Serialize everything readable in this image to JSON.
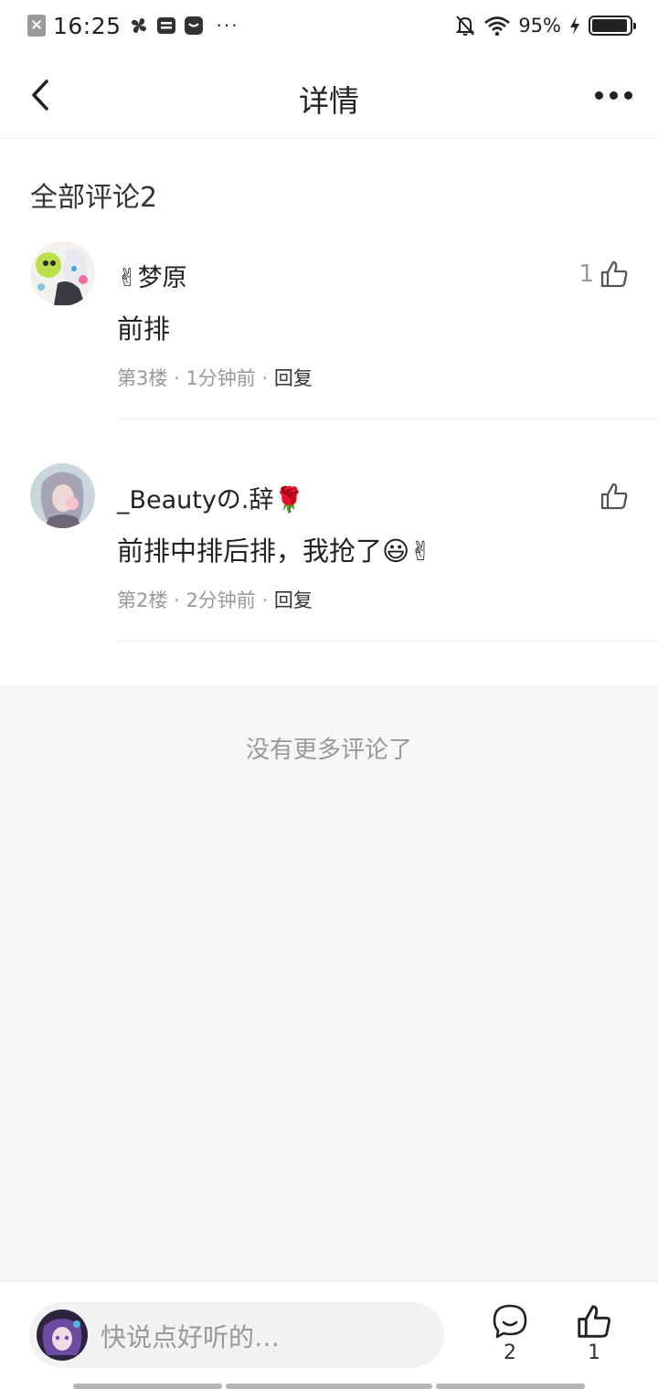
{
  "status_bar": {
    "time": "16:25",
    "battery_percent": "95%",
    "icons": [
      "sim-error-icon",
      "pinwheel-app-icon",
      "message-app-icon",
      "taobao-app-icon",
      "more-notifications-icon",
      "mute-bell-icon",
      "wifi-icon",
      "charging-icon",
      "battery-icon"
    ]
  },
  "header": {
    "title": "详情",
    "back_icon": "chevron-left-icon",
    "more_icon": "more-dots-icon"
  },
  "comments_section": {
    "title": "全部评论2",
    "comments": [
      {
        "username": "✌梦原",
        "text": "前排",
        "floor": "第3楼",
        "sep1": "·",
        "time": "1分钟前",
        "sep2": "·",
        "reply_label": "回复",
        "like_count": "1"
      },
      {
        "username": "_Beautyの.辞🌹",
        "text": "前排中排后排，我抢了😃✌",
        "floor": "第2楼",
        "sep1": "·",
        "time": "2分钟前",
        "sep2": "·",
        "reply_label": "回复",
        "like_count": ""
      }
    ],
    "end_text": "没有更多评论了"
  },
  "bottom_bar": {
    "input_placeholder": "快说点好听的…",
    "comment_count": "2",
    "like_count": "1"
  },
  "colors": {
    "text_primary": "#222222",
    "text_secondary": "#999999",
    "background_empty": "#f6f6f6",
    "input_background": "#f2f2f2"
  }
}
